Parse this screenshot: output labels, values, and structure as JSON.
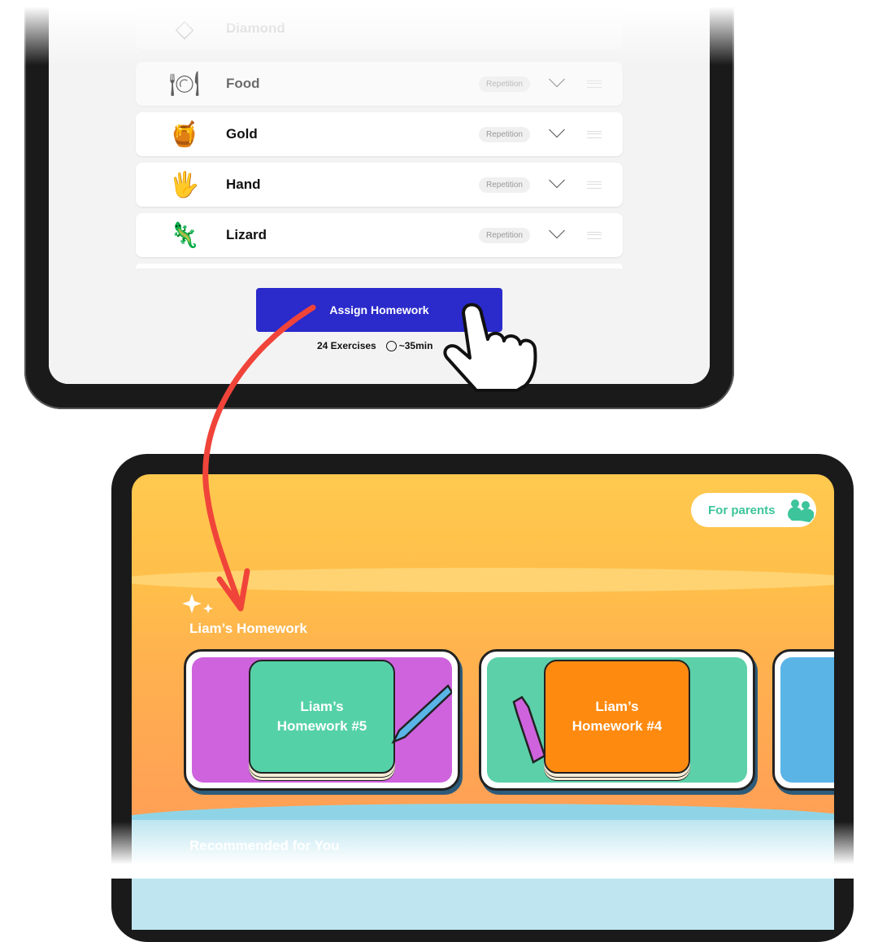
{
  "top_screen": {
    "rows": [
      {
        "label": "Diamond",
        "icon": "diamond-icon",
        "badge": "",
        "faded": true
      },
      {
        "label": "Food",
        "icon": "food-plate-icon",
        "badge": "Repetition",
        "faded": true
      },
      {
        "label": "Gold",
        "icon": "gold-pot-icon",
        "badge": "Repetition"
      },
      {
        "label": "Hand",
        "icon": "hand-icon",
        "badge": "Repetition"
      },
      {
        "label": "Lizard",
        "icon": "lizard-icon",
        "badge": "Repetition"
      }
    ],
    "assign_button": "Assign Homework",
    "exercises": "24 Exercises",
    "duration": "~35min",
    "accent": "#2B2ACB"
  },
  "bottom_screen": {
    "for_parents": "For parents",
    "section_title": "Liam’s Homework",
    "cards": [
      {
        "line1": "Liam’s",
        "line2": "Homework #5",
        "bg": "#CF63DE",
        "book": "#55D1A8"
      },
      {
        "line1": "Liam’s",
        "line2": "Homework #4",
        "bg": "#5CD0A9",
        "book": "#FF8A10"
      },
      {
        "line1": "",
        "line2": "",
        "bg": "#5AB4E6",
        "book": ""
      }
    ],
    "next_section": "Recommended for You"
  }
}
